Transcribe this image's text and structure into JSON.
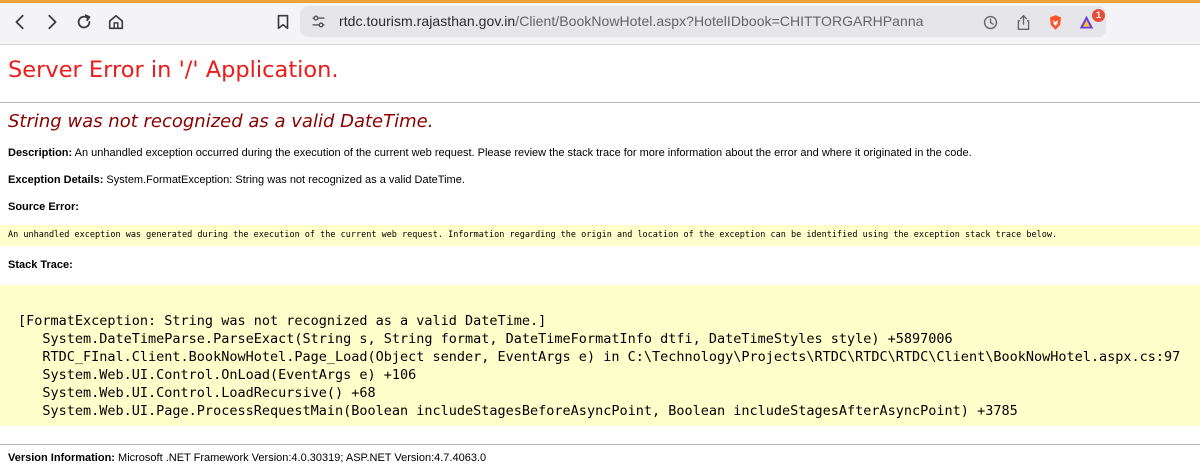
{
  "browser": {
    "url_host": "rtdc.tourism.rajasthan.gov.in",
    "url_path": "/Client/BookNowHotel.aspx?HotelIDbook=CHITTORGARHPanna",
    "extension_badge": "1",
    "accent_color": "#f0a23a",
    "icons": [
      "back-icon",
      "forward-icon",
      "reload-icon",
      "home-icon",
      "bookmark-icon",
      "site-settings-icon",
      "history-icon",
      "share-icon",
      "brave-shield-icon",
      "brave-rewards-icon"
    ]
  },
  "page": {
    "title": "Server Error in '/' Application.",
    "error_message": "String was not recognized as a valid DateTime.",
    "description_label": "Description:",
    "description_text": "An unhandled exception occurred during the execution of the current web request. Please review the stack trace for more information about the error and where it originated in the code.",
    "exception_label": "Exception Details:",
    "exception_text": "System.FormatException: String was not recognized as a valid DateTime.",
    "source_error_label": "Source Error:",
    "source_error_text": "An unhandled exception was generated during the execution of the current web request. Information regarding the origin and location of the exception can be identified using the exception stack trace below.",
    "stack_trace_label": "Stack Trace:",
    "stack_trace": [
      "[FormatException: String was not recognized as a valid DateTime.]",
      "   System.DateTimeParse.ParseExact(String s, String format, DateTimeFormatInfo dtfi, DateTimeStyles style) +5897006",
      "   RTDC_FInal.Client.BookNowHotel.Page_Load(Object sender, EventArgs e) in C:\\Technology\\Projects\\RTDC\\RTDC\\RTDC\\Client\\BookNowHotel.aspx.cs:97",
      "   System.Web.UI.Control.OnLoad(EventArgs e) +106",
      "   System.Web.UI.Control.LoadRecursive() +68",
      "   System.Web.UI.Page.ProcessRequestMain(Boolean includeStagesBeforeAsyncPoint, Boolean includeStagesAfterAsyncPoint) +3785"
    ],
    "version_label": "Version Information:",
    "version_text": "Microsoft .NET Framework Version:4.0.30319; ASP.NET Version:4.7.4063.0",
    "colors": {
      "title_red": "#ee1b1b",
      "error_maroon": "#8b0000",
      "code_background": "#ffffcc"
    }
  }
}
